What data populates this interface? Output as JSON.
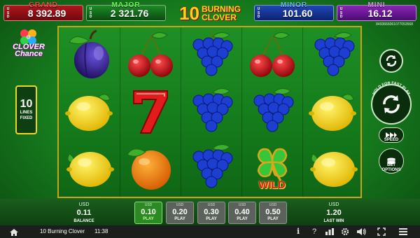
{
  "jackpots": {
    "grand": {
      "name": "GRAND",
      "currency": "USD",
      "value": "8 392.89"
    },
    "major": {
      "name": "MAJOR",
      "currency": "USD",
      "value": "2 321.76"
    },
    "minor": {
      "name": "MINOR",
      "currency": "USD",
      "value": "101.60"
    },
    "mini": {
      "name": "MINI",
      "currency": "USD",
      "value": "16.12"
    }
  },
  "logo": {
    "number": "10",
    "line1": "BURNING",
    "line2": "CLOVER"
  },
  "round_id": "8493666061077053568",
  "clover_chance": {
    "line1": "CLOVER",
    "line2": "Chance"
  },
  "lines": {
    "count": "10",
    "label1": "LINES",
    "label2": "FIXED"
  },
  "reels": [
    [
      "plum",
      "lemon",
      "lemon"
    ],
    [
      "cherry",
      "seven",
      "orange"
    ],
    [
      "grapes",
      "grapes",
      "grapes"
    ],
    [
      "cherry",
      "grapes",
      "wild"
    ],
    [
      "grapes",
      "lemon",
      "lemon"
    ]
  ],
  "wild_label": "WILD",
  "controls": {
    "autoplay_icon": "autoplay-icon",
    "spin_hint": "HOLD FOR FAST PLAY",
    "speed_label": "SPEED",
    "bet_options_line1": "BET",
    "bet_options_line2": "OPTIONS"
  },
  "balance": {
    "currency": "USD",
    "value": "0.11",
    "label": "BALANCE"
  },
  "last_win": {
    "currency": "USD",
    "value": "1.20",
    "label": "LAST WIN"
  },
  "bets": [
    {
      "currency": "USD",
      "value": "0.10",
      "label": "PLAY",
      "active": true
    },
    {
      "currency": "USD",
      "value": "0.20",
      "label": "PLAY",
      "active": false
    },
    {
      "currency": "USD",
      "value": "0.30",
      "label": "PLAY",
      "active": false
    },
    {
      "currency": "USD",
      "value": "0.40",
      "label": "PLAY",
      "active": false
    },
    {
      "currency": "USD",
      "value": "0.50",
      "label": "PLAY",
      "active": false
    }
  ],
  "system_bar": {
    "title": "10 Burning Clover",
    "time": "11:38"
  },
  "colors": {
    "grand": "#b0161c",
    "major": "#1d8a26",
    "minor": "#1f46b8",
    "mini": "#8a25b8",
    "reel_border": "#c9a318",
    "active_bet": "#2c8a22"
  }
}
